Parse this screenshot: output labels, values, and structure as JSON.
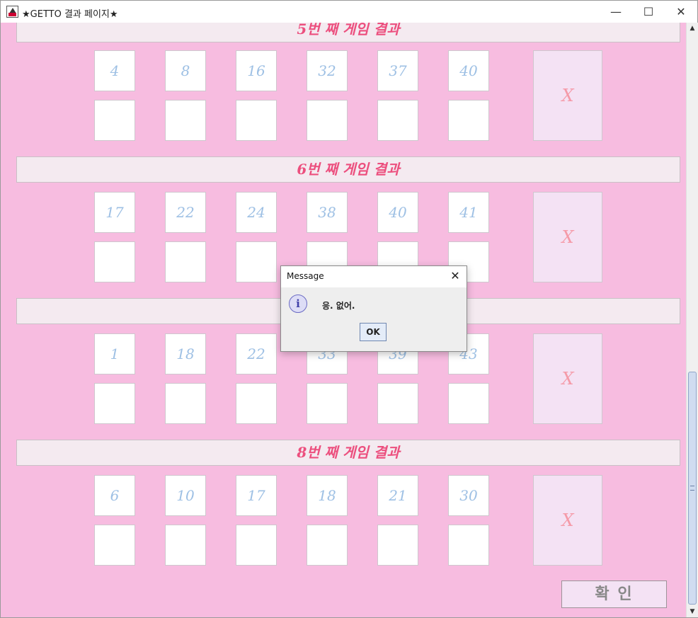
{
  "window": {
    "title": "★GETTO 결과 페이지★",
    "minimize": "—",
    "maximize": "☐",
    "close": "✕",
    "icon": "app-logo-icon"
  },
  "games": [
    {
      "title": "5번 째 게임 결과",
      "numbers": [
        "4",
        "8",
        "16",
        "32",
        "37",
        "40"
      ],
      "result": "X"
    },
    {
      "title": "6번 째 게임 결과",
      "numbers": [
        "17",
        "22",
        "24",
        "38",
        "40",
        "41"
      ],
      "result": "X"
    },
    {
      "title": "",
      "numbers": [
        "1",
        "18",
        "22",
        "33",
        "39",
        "43"
      ],
      "result": "X"
    },
    {
      "title": "8번 째 게임 결과",
      "numbers": [
        "6",
        "10",
        "17",
        "18",
        "21",
        "30"
      ],
      "result": "X"
    }
  ],
  "confirm_button": "확  인",
  "scrollbar": {
    "up": "▲",
    "down": "▼",
    "position": 0.59
  },
  "dialog": {
    "title": "Message",
    "close": "✕",
    "icon": "info-icon",
    "icon_glyph": "i",
    "message": "응. 없어.",
    "ok": "OK"
  },
  "colors": {
    "background": "#f7bce0",
    "header_text": "#ec4f7e",
    "number_text": "#9ec0e4",
    "result_text": "#f59aa8"
  }
}
